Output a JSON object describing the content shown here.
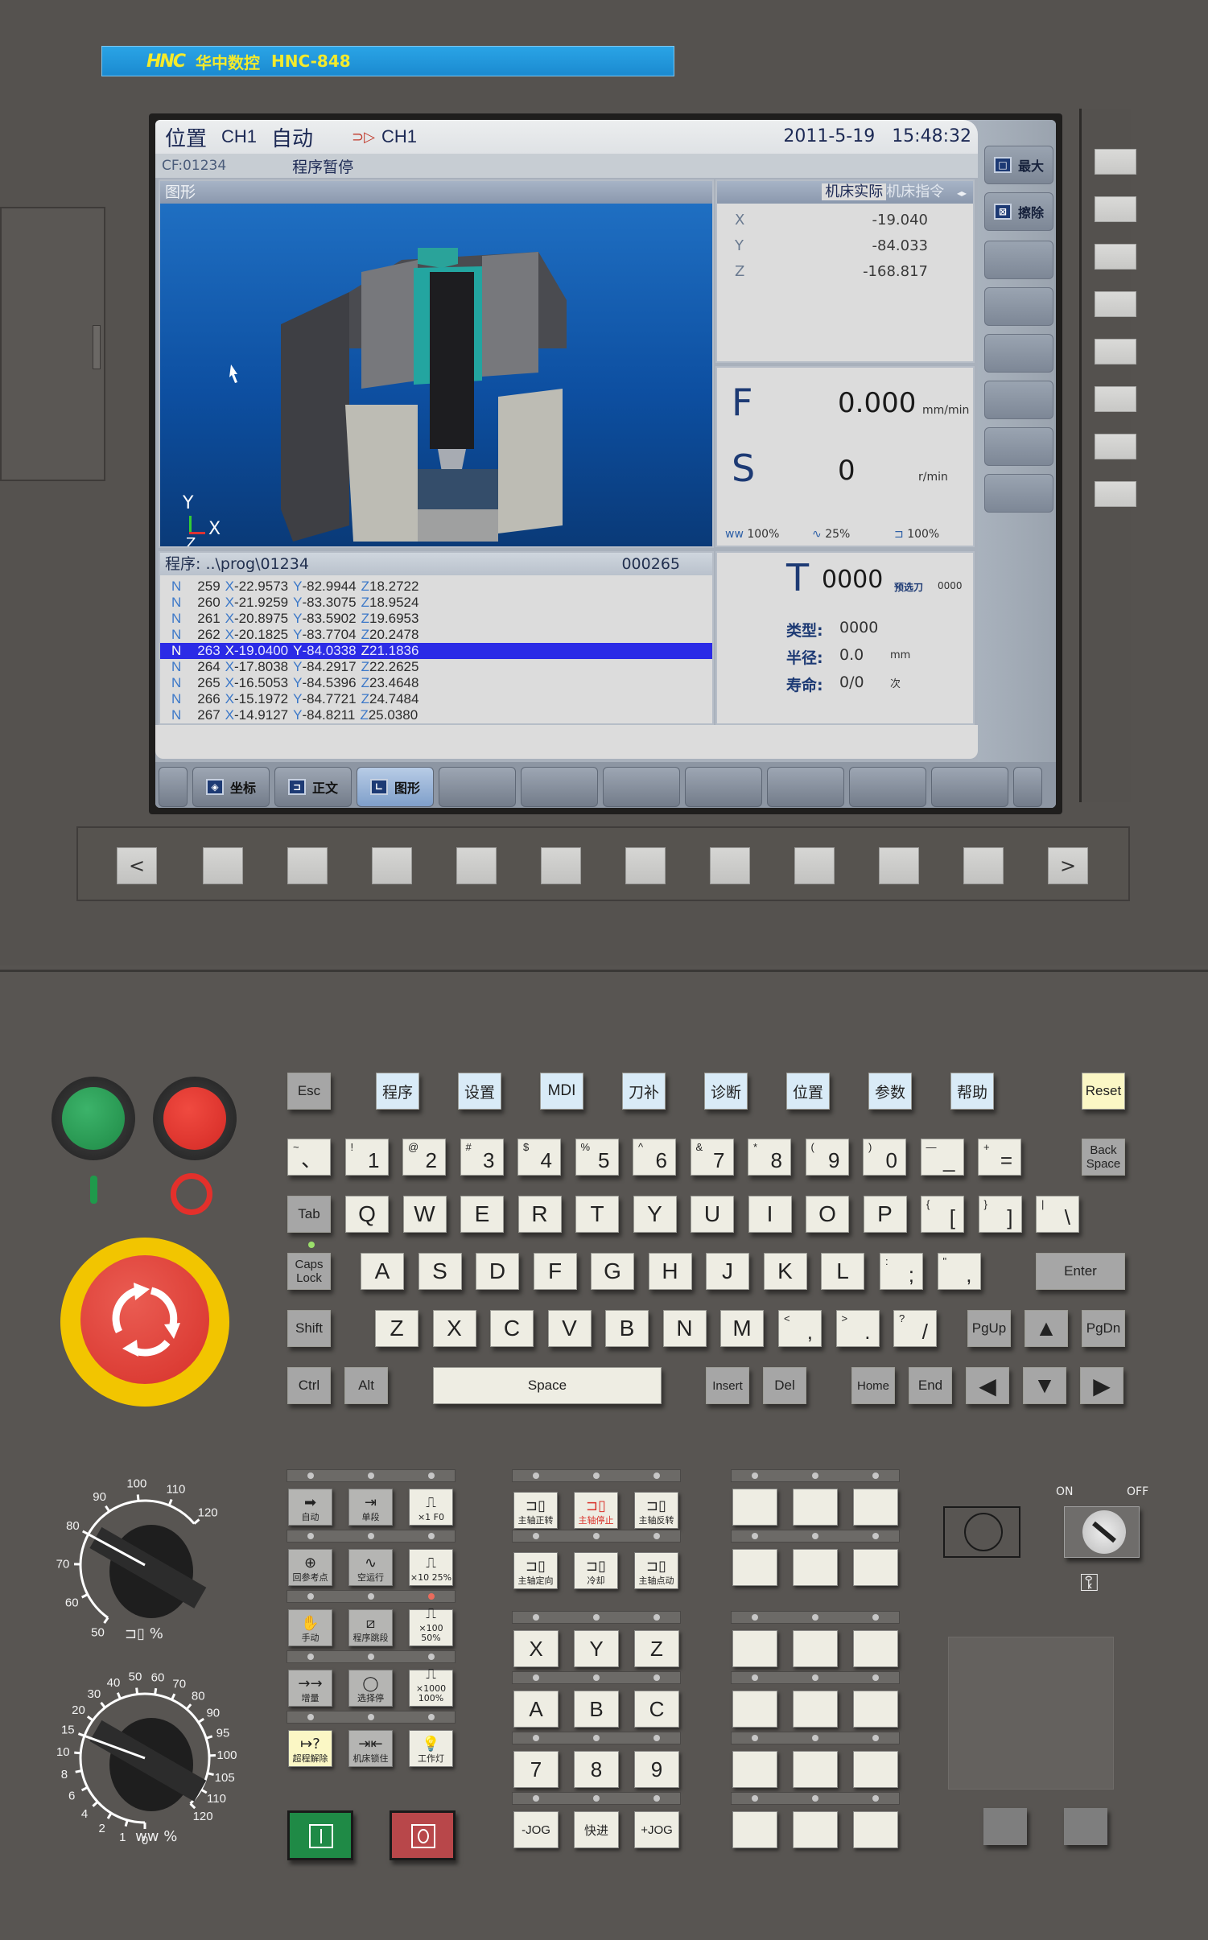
{
  "brand": {
    "mark": "HNC",
    "name": "华中数控",
    "model": "HNC-848"
  },
  "screen": {
    "header": {
      "page": "位置",
      "channel": "CH1",
      "mode": "自动",
      "channel2": "CH1",
      "date": "2011-5-19",
      "time": "15:48:32"
    },
    "subheader": {
      "program_file": "CF:01234",
      "status": "程序暂停"
    },
    "graphics": {
      "title": "图形",
      "axis_y": "Y",
      "axis_x": "X",
      "axis_z": "Z"
    },
    "position": {
      "tab_active": "机床实际",
      "tab_inactive": "机床指令",
      "axes": [
        {
          "label": "X",
          "value": "-19.040"
        },
        {
          "label": "Y",
          "value": "-84.033"
        },
        {
          "label": "Z",
          "value": "-168.817"
        }
      ]
    },
    "feed": {
      "label": "F",
      "value": "0.000",
      "unit": "mm/min"
    },
    "spindle": {
      "label": "S",
      "value": "0",
      "unit": "r/min"
    },
    "overrides": {
      "feed": "100%",
      "rapid": "25%",
      "spindle": "100%"
    },
    "program": {
      "title": "程序:",
      "path": "..\\prog\\01234",
      "line_count": "000265",
      "highlight_index": 4,
      "lines": [
        {
          "n": "259",
          "x": "-22.9573",
          "y": "-82.9944",
          "z": "18.2722"
        },
        {
          "n": "260",
          "x": "-21.9259",
          "y": "-83.3075",
          "z": "18.9524"
        },
        {
          "n": "261",
          "x": "-20.8975",
          "y": "-83.5902",
          "z": "19.6953"
        },
        {
          "n": "262",
          "x": "-20.1825",
          "y": "-83.7704",
          "z": "20.2478"
        },
        {
          "n": "263",
          "x": "-19.0400",
          "y": "-84.0338",
          "z": "21.1836"
        },
        {
          "n": "264",
          "x": "-17.8038",
          "y": "-84.2917",
          "z": "22.2625"
        },
        {
          "n": "265",
          "x": "-16.5053",
          "y": "-84.5396",
          "z": "23.4648"
        },
        {
          "n": "266",
          "x": "-15.1972",
          "y": "-84.7721",
          "z": "24.7484"
        },
        {
          "n": "267",
          "x": "-14.9127",
          "y": "-84.8211",
          "z": "25.0380"
        }
      ]
    },
    "tool": {
      "label": "T",
      "value": "0000",
      "preselect_label": "预选刀",
      "preselect_value": "0000",
      "type_label": "类型:",
      "type_value": "0000",
      "radius_label": "半径:",
      "radius_value": "0.0",
      "radius_unit": "mm",
      "life_label": "寿命:",
      "life_value": "0/0",
      "life_unit": "次"
    },
    "right_buttons": [
      {
        "label": "最大",
        "icon": "maximize-icon"
      },
      {
        "label": "擦除",
        "icon": "erase-icon"
      },
      {
        "label": ""
      },
      {
        "label": ""
      },
      {
        "label": ""
      },
      {
        "label": ""
      },
      {
        "label": ""
      },
      {
        "label": ""
      }
    ],
    "softkeys": [
      {
        "label": ""
      },
      {
        "label": "坐标",
        "icon": "coordinate-icon"
      },
      {
        "label": "正文",
        "icon": "text-icon"
      },
      {
        "label": "图形",
        "icon": "graphics-icon",
        "active": true
      },
      {
        "label": ""
      },
      {
        "label": ""
      },
      {
        "label": ""
      },
      {
        "label": ""
      },
      {
        "label": ""
      },
      {
        "label": ""
      },
      {
        "label": ""
      },
      {
        "label": ""
      }
    ]
  },
  "bottom_nav": {
    "prev": "<",
    "next": ">"
  },
  "keyboard": {
    "function_keys": [
      "程序",
      "设置",
      "MDI",
      "刀补",
      "诊断",
      "位置",
      "参数",
      "帮助"
    ],
    "esc": "Esc",
    "reset": "Reset",
    "number_row": [
      {
        "shift": "~",
        "main": "、"
      },
      {
        "shift": "!",
        "main": "1"
      },
      {
        "shift": "@",
        "main": "2"
      },
      {
        "shift": "#",
        "main": "3"
      },
      {
        "shift": "$",
        "main": "4"
      },
      {
        "shift": "%",
        "main": "5"
      },
      {
        "shift": "^",
        "main": "6"
      },
      {
        "shift": "&",
        "main": "7"
      },
      {
        "shift": "*",
        "main": "8"
      },
      {
        "shift": "(",
        "main": "9"
      },
      {
        "shift": ")",
        "main": "0"
      },
      {
        "shift": "—",
        "main": "_"
      },
      {
        "shift": "+",
        "main": "="
      }
    ],
    "backspace": "Back Space",
    "tab": "Tab",
    "qwerty_row": [
      "Q",
      "W",
      "E",
      "R",
      "T",
      "Y",
      "U",
      "I",
      "O",
      "P"
    ],
    "qwerty_extra": [
      {
        "shift": "{",
        "main": "["
      },
      {
        "shift": "}",
        "main": "]"
      },
      {
        "shift": "|",
        "main": "\\"
      }
    ],
    "caps": "Caps Lock",
    "asdf_row": [
      "A",
      "S",
      "D",
      "F",
      "G",
      "H",
      "J",
      "K",
      "L"
    ],
    "asdf_extra": [
      {
        "shift": ":",
        "main": ";"
      },
      {
        "shift": "\"",
        "main": ","
      }
    ],
    "enter": "Enter",
    "shift": "Shift",
    "zxcv_row": [
      "Z",
      "X",
      "C",
      "V",
      "B",
      "N",
      "M"
    ],
    "zxcv_extra": [
      {
        "shift": "<",
        "main": ","
      },
      {
        "shift": ">",
        "main": "."
      },
      {
        "shift": "?",
        "main": "/"
      }
    ],
    "pgup": "PgUp",
    "up": "▲",
    "pgdn": "PgDn",
    "ctrl": "Ctrl",
    "alt": "Alt",
    "space": "Space",
    "insert": "Insert",
    "del": "Del",
    "home": "Home",
    "end": "End",
    "left": "◀",
    "down": "▼",
    "right": "▶"
  },
  "machine_panel": {
    "power_on_symbol": "I",
    "power_off_symbol": "O",
    "mode_keys": [
      [
        {
          "label": "自动",
          "glyph": "➡"
        },
        {
          "label": "单段",
          "glyph": "⇥"
        },
        {
          "label": "×1 F0",
          "glyph": "⎍"
        }
      ],
      [
        {
          "label": "回参考点",
          "glyph": "⊕"
        },
        {
          "label": "空运行",
          "glyph": "∿"
        },
        {
          "label": "×10 25%",
          "glyph": "⎍"
        }
      ],
      [
        {
          "label": "手动",
          "glyph": "✋"
        },
        {
          "label": "程序跳段",
          "glyph": "⧄"
        },
        {
          "label": "×100 50%",
          "glyph": "⎍"
        }
      ],
      [
        {
          "label": "增量",
          "glyph": "→→"
        },
        {
          "label": "选择停",
          "glyph": "◯"
        },
        {
          "label": "×1000 100%",
          "glyph": "⎍"
        }
      ],
      [
        {
          "label": "超程解除",
          "glyph": "↦?"
        },
        {
          "label": "机床锁住",
          "glyph": "⇥⇤"
        },
        {
          "label": "工作灯",
          "glyph": "💡"
        }
      ]
    ],
    "active_led": {
      "row": 2,
      "col": 2
    },
    "spindle_keys": [
      [
        {
          "label": "主轴正转"
        },
        {
          "label": "主轴停止",
          "color": "#d9322b"
        },
        {
          "label": "主轴反转"
        }
      ],
      [
        {
          "label": "主轴定向"
        },
        {
          "label": "冷却"
        },
        {
          "label": "主轴点动"
        }
      ]
    ],
    "axis_keys": [
      [
        "X",
        "Y",
        "Z"
      ],
      [
        "A",
        "B",
        "C"
      ],
      [
        "7",
        "8",
        "9"
      ],
      [
        "-JOG",
        "快进",
        "+JOG"
      ]
    ],
    "key_switch": {
      "on": "ON",
      "off": "OFF"
    },
    "spindle_override_dial": {
      "ticks": [
        "50",
        "60",
        "70",
        "80",
        "90",
        "100",
        "110",
        "120"
      ],
      "unit": "%",
      "value": 80
    },
    "feed_override_dial": {
      "ticks": [
        "0",
        "1",
        "2",
        "4",
        "6",
        "8",
        "10",
        "15",
        "20",
        "30",
        "40",
        "50",
        "60",
        "70",
        "80",
        "90",
        "95",
        "100",
        "105",
        "110",
        "120"
      ],
      "unit": "%",
      "value": 15
    }
  },
  "colors": {
    "accent": "#2b2be6",
    "brand_bar": "#1b8ad0",
    "brand_text": "#f3ea2c",
    "estop": "#e03a2f",
    "estop_ring": "#f2c500",
    "start": "#1f9a4b",
    "stop": "#e4302b"
  }
}
